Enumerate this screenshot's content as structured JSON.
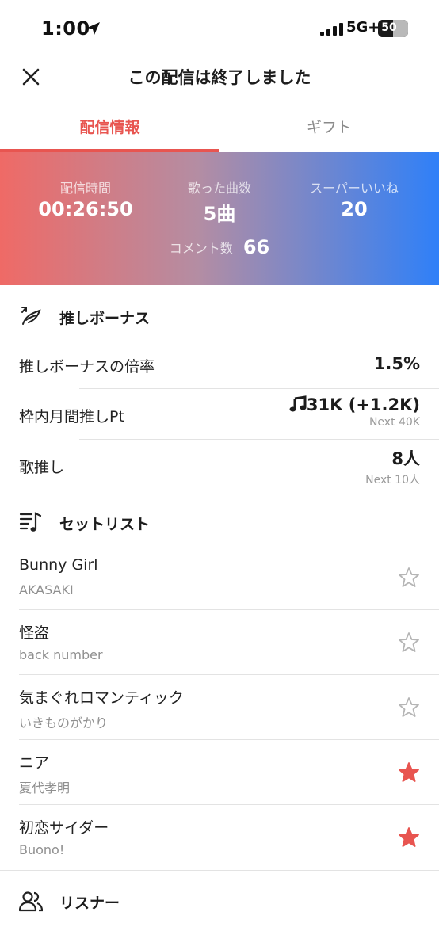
{
  "status_bar": {
    "time": "1:00",
    "network": "5G+",
    "battery": "50",
    "battery_level": 0.5
  },
  "header": {
    "title": "この配信は終了しました",
    "close_icon": "close-icon"
  },
  "tabs": [
    {
      "label": "配信情報",
      "active": true
    },
    {
      "label": "ギフト",
      "active": false
    }
  ],
  "stats": {
    "duration": {
      "label": "配信時間",
      "value": "00:26:50"
    },
    "songs": {
      "label": "歌った曲数",
      "value": "5曲"
    },
    "super_likes": {
      "label": "スーパーいいね",
      "value": "20"
    },
    "comments": {
      "label": "コメント数",
      "value": "66"
    }
  },
  "bonus": {
    "title": "推しボーナス",
    "icon": "wing-icon",
    "rows": [
      {
        "label": "推しボーナスの倍率",
        "value": "1.5%",
        "sub": ""
      },
      {
        "label": "枠内月間推しPt",
        "value": "31K (+1.2K)",
        "sub": "Next 40K",
        "icon": "music-note-icon"
      },
      {
        "label": "歌推し",
        "value": "8人",
        "sub": "Next 10人"
      }
    ]
  },
  "setlist": {
    "title": "セットリスト",
    "icon": "playlist-icon",
    "songs": [
      {
        "name": "Bunny Girl",
        "artist": "AKASAKI",
        "starred": false
      },
      {
        "name": "怪盗",
        "artist": "back number",
        "starred": false
      },
      {
        "name": "気まぐれロマンティック",
        "artist": "いきものがかり",
        "starred": false
      },
      {
        "name": "ニア",
        "artist": "夏代孝明",
        "starred": true
      },
      {
        "name": "初恋サイダー",
        "artist": "Buono!",
        "starred": true
      }
    ]
  },
  "listeners": {
    "title": "リスナー",
    "icon": "users-icon"
  },
  "colors": {
    "accent": "#e85550",
    "gradient_start": "#ef6a66",
    "gradient_end": "#2f80f8",
    "star_active": "#e85550",
    "star_inactive": "#b5b5b5"
  }
}
